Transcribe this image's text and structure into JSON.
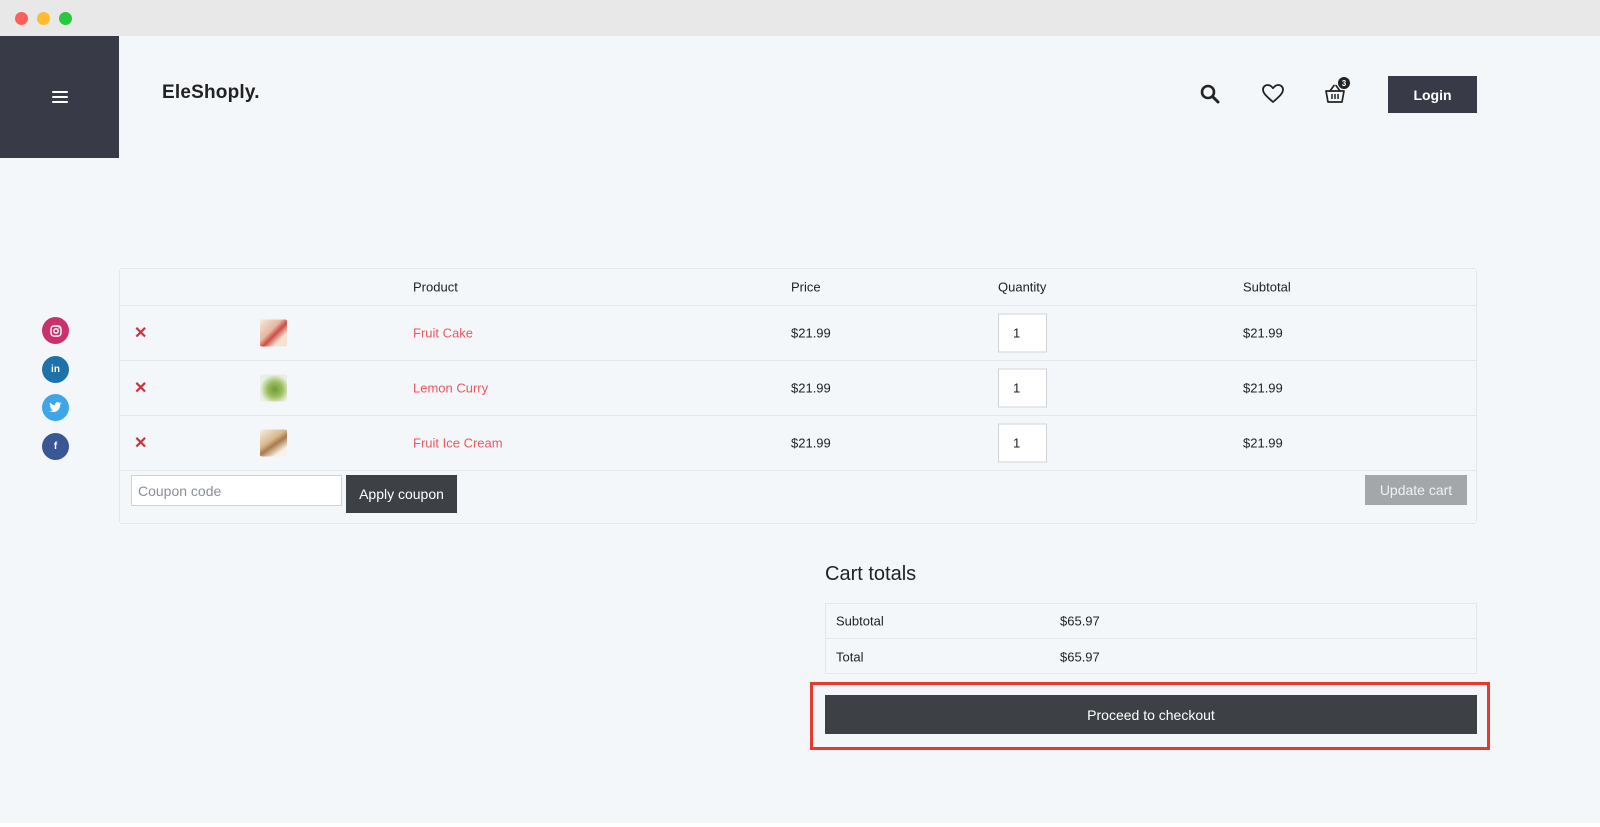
{
  "brand": {
    "logo_text": "EleShoply."
  },
  "header": {
    "login_label": "Login",
    "cart_count": "3"
  },
  "cart_table": {
    "columns": [
      "",
      "",
      "Product",
      "Price",
      "Quantity",
      "Subtotal"
    ],
    "items": [
      {
        "remove": "✕",
        "name": "Fruit Cake",
        "price": "$21.99",
        "qty": "1",
        "subtotal": "$21.99"
      },
      {
        "remove": "✕",
        "name": "Lemon Curry",
        "price": "$21.99",
        "qty": "1",
        "subtotal": "$21.99"
      },
      {
        "remove": "✕",
        "name": "Fruit Ice Cream",
        "price": "$21.99",
        "qty": "1",
        "subtotal": "$21.99"
      }
    ],
    "coupon_placeholder": "Coupon code",
    "apply_label": "Apply coupon",
    "update_label": "Update cart"
  },
  "totals": {
    "title": "Cart totals",
    "rows": [
      {
        "label": "Subtotal",
        "value": "$65.97"
      },
      {
        "label": "Total",
        "value": "$65.97"
      }
    ],
    "checkout_label": "Proceed to checkout"
  },
  "social": {
    "icons": [
      "instagram-icon",
      "linkedin-icon",
      "twitter-icon",
      "facebook-icon"
    ]
  },
  "colors": {
    "dark": "#383b47",
    "button_dark": "#3d4146",
    "product_link": "#e8595f",
    "remove": "#d0303a",
    "highlight": "#e8392f",
    "page_bg": "#f4f7fa"
  }
}
